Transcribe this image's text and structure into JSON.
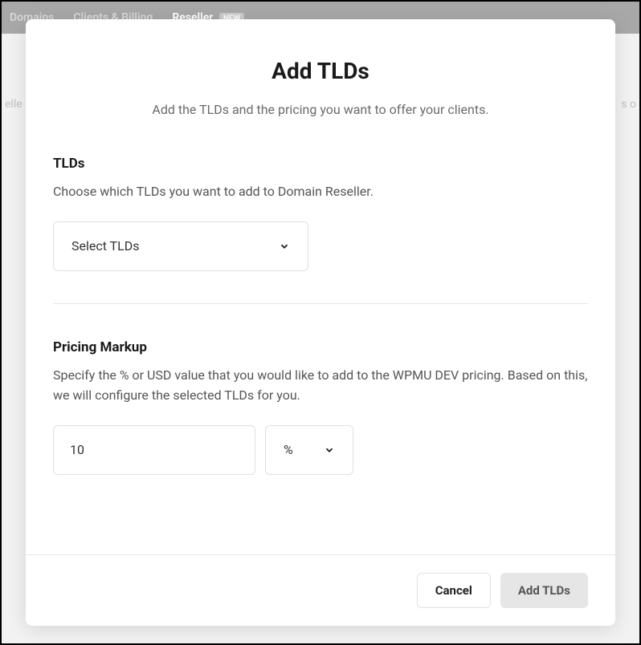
{
  "nav": {
    "items": [
      {
        "label": "Domains"
      },
      {
        "label": "Clients & Billing"
      },
      {
        "label": "Reseller",
        "badge": "NEW"
      }
    ]
  },
  "bg": {
    "left": "elle",
    "right": "s o"
  },
  "modal": {
    "title": "Add TLDs",
    "subtitle": "Add the TLDs and the pricing you want to offer your clients.",
    "tlds": {
      "heading": "TLDs",
      "description": "Choose which TLDs you want to add to Domain Reseller.",
      "select_label": "Select TLDs"
    },
    "pricing": {
      "heading": "Pricing Markup",
      "description": "Specify the % or USD value that you would like to add to the WPMU DEV pricing. Based on this, we will configure the selected TLDs for you.",
      "value": "10",
      "unit": "%"
    },
    "actions": {
      "cancel": "Cancel",
      "submit": "Add TLDs"
    }
  }
}
